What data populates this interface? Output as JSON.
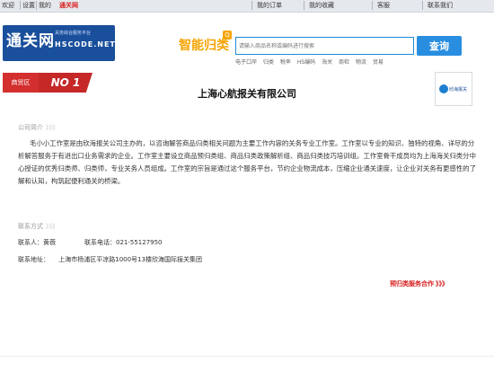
{
  "top_bar": {
    "links": [
      "欢迎",
      "设置",
      "我的",
      "通关网",
      "我的订单",
      "我的收藏",
      "客服",
      "联系我们"
    ]
  },
  "header": {
    "logo_main": "通关网",
    "logo_slogan": "关务综合服务平台",
    "logo_sub": "HSCODE.NET",
    "brand": "智能归类",
    "brand_badge": "Q",
    "search_placeholder": "请输入商品名称或编码进行搜索",
    "search_button": "查询",
    "sub_links": [
      "电子口岸",
      "归类",
      "税率",
      "HS编码",
      "海关",
      "商检",
      "物流",
      "贸易"
    ]
  },
  "badge": {
    "left": "商贸区",
    "right": "NO 1"
  },
  "partner": {
    "name": "欣海报关"
  },
  "company_name": "上海心航报关有限公司",
  "sections": {
    "intro_title": "公司简介",
    "intro_paragraph_1": "毛小小工作室是由欣海报关公司主办的，以咨询解答商品归类相关问题为主要工作内容的关务专业工作室。工作室以专业的知识、独特的视角、详尽的分析解答服务于有进出口业务需求的企业。工作室主要设立商品预归类组、商品归类政策解析组、商品归类技巧培训组。工作室骨干成员均为上海海关归类分中心授证的优秀归类师、归类师，专业关务人员组成。工作室的宗旨是通过这个服务平台，节约企业物流成本，压缩企业通关速度，让企业对关务有更感性的了解和认知，构筑起便利通关的桥梁。",
    "contact_title": "联系方式",
    "contact_person_label": "联系人：",
    "contact_person": "黄薇",
    "contact_phone_label": "联系电话：",
    "contact_phone": "021-55127950",
    "address_label": "联系地址：",
    "address": "上海市杨浦区平凉路1000号13楼欣海国际报关集团",
    "arrows": "》》》"
  },
  "service_link": "预归类服务合作"
}
